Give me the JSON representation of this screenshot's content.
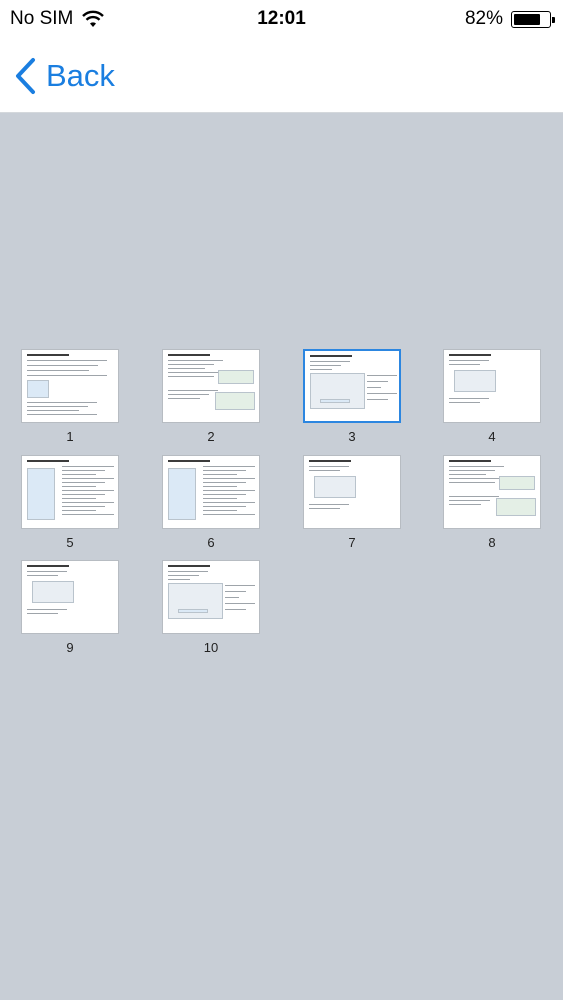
{
  "status_bar": {
    "carrier": "No SIM",
    "time": "12:01",
    "battery_percent": "82%",
    "battery_level": 0.82,
    "wifi_icon": "wifi-icon",
    "battery_icon": "battery-icon"
  },
  "nav": {
    "back_label": "Back",
    "back_icon": "chevron-left-icon",
    "accent_color": "#1a7ee0"
  },
  "thumbnails": [
    {
      "label": "1",
      "selected": false
    },
    {
      "label": "2",
      "selected": false
    },
    {
      "label": "3",
      "selected": true
    },
    {
      "label": "4",
      "selected": false
    },
    {
      "label": "5",
      "selected": false
    },
    {
      "label": "6",
      "selected": false
    },
    {
      "label": "7",
      "selected": false
    },
    {
      "label": "8",
      "selected": false
    },
    {
      "label": "9",
      "selected": false
    },
    {
      "label": "10",
      "selected": false
    }
  ],
  "colors": {
    "background": "#c8ced6",
    "selection_border": "#2c86e0"
  }
}
